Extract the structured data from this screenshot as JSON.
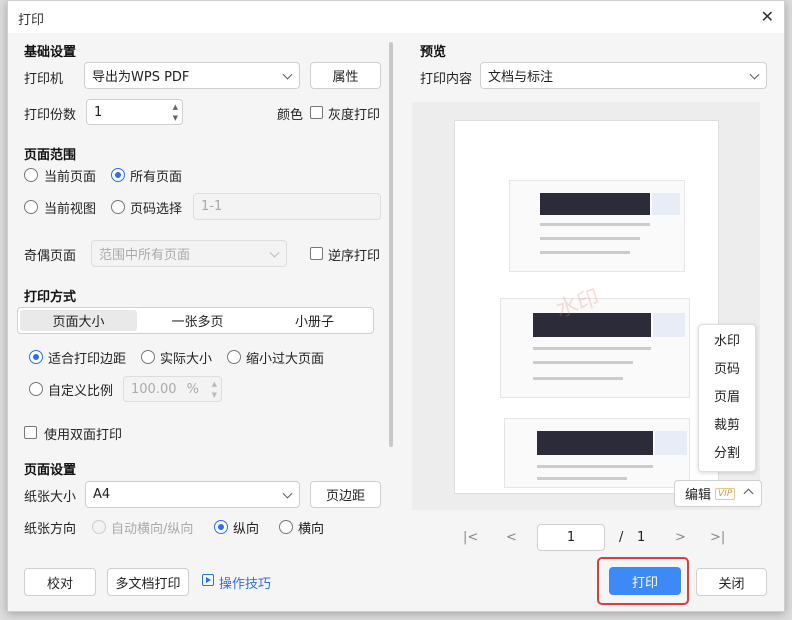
{
  "dialog": {
    "title": "打印",
    "close_icon": "✕"
  },
  "basic": {
    "heading": "基础设置",
    "printer_label": "打印机",
    "printer_value": "导出为WPS PDF",
    "properties_button": "属性",
    "copies_label": "打印份数",
    "copies_value": "1",
    "color_label": "颜色",
    "grayscale_label": "灰度打印"
  },
  "range": {
    "heading": "页面范围",
    "current_page": "当前页面",
    "all_pages": "所有页面",
    "current_view": "当前视图",
    "page_select": "页码选择",
    "page_select_value": "1-1",
    "odd_even_label": "奇偶页面",
    "odd_even_value": "范围中所有页面",
    "reverse_label": "逆序打印"
  },
  "mode": {
    "heading": "打印方式",
    "tabs": [
      "页面大小",
      "一张多页",
      "小册子"
    ],
    "fit_margins": "适合打印边距",
    "actual_size": "实际大小",
    "shrink_large": "缩小过大页面",
    "custom_scale": "自定义比例",
    "scale_value": "100.00",
    "scale_unit": "%",
    "duplex_label": "使用双面打印"
  },
  "page_setup": {
    "heading": "页面设置",
    "paper_size_label": "纸张大小",
    "paper_size_value": "A4",
    "margins_button": "页边距",
    "orientation_label": "纸张方向",
    "auto_orientation": "自动横向/纵向",
    "portrait": "纵向",
    "landscape": "横向"
  },
  "footer": {
    "proof_button": "校对",
    "multi_doc_button": "多文档打印",
    "tips_link": "操作技巧",
    "print_button": "打印",
    "close_button": "关闭"
  },
  "preview": {
    "heading": "预览",
    "content_label": "打印内容",
    "content_value": "文档与标注",
    "watermark": "水印",
    "edit_button": "编辑",
    "vip_badge": "VIP",
    "menu": [
      "水印",
      "页码",
      "页眉",
      "裁剪",
      "分割"
    ],
    "page_current": "1",
    "page_sep": "/",
    "page_total": "1"
  },
  "colors": {
    "accent": "#3d8af7",
    "highlight": "#e53935"
  }
}
